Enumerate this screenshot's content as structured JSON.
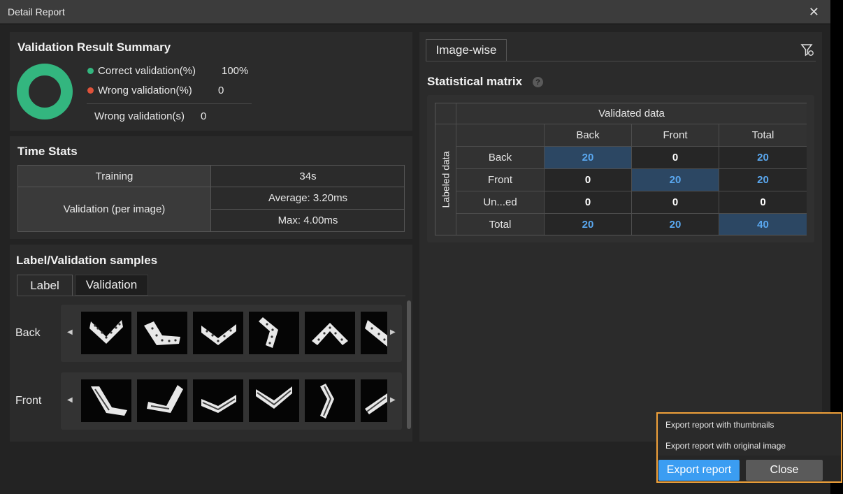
{
  "window": {
    "title": "Detail Report",
    "close_glyph": "✕"
  },
  "summary": {
    "title": "Validation Result Summary",
    "correct_label": "Correct validation(%)",
    "correct_value": "100%",
    "wrong_label": "Wrong validation(%)",
    "wrong_value": "0",
    "wrong_count_label": "Wrong validation(s)",
    "wrong_count_value": "0",
    "correct_fraction": 1.0,
    "colors": {
      "correct": "#33b67f",
      "wrong": "#e0523a"
    }
  },
  "time_stats": {
    "title": "Time Stats",
    "training_label": "Training",
    "training_value": "34s",
    "validation_label": "Validation (per image)",
    "average": "Average: 3.20ms",
    "max": "Max: 4.00ms"
  },
  "samples": {
    "title": "Label/Validation samples",
    "tabs": [
      "Label",
      "Validation"
    ],
    "rows": [
      {
        "label": "Back"
      },
      {
        "label": "Front"
      }
    ]
  },
  "matrix": {
    "tab": "Image-wise",
    "title": "Statistical matrix",
    "help_glyph": "?",
    "top_header": "Validated data",
    "side_header": "Labeled data",
    "col_headers": [
      "Back",
      "Front",
      "Total"
    ],
    "row_headers": [
      "Back",
      "Front",
      "Un...ed",
      "Total"
    ],
    "cells": [
      [
        "20",
        "0",
        "20"
      ],
      [
        "0",
        "20",
        "20"
      ],
      [
        "0",
        "0",
        "0"
      ],
      [
        "20",
        "20",
        "40"
      ]
    ]
  },
  "export": {
    "menu": [
      "Export report with thumbnails",
      "Export report with original image"
    ],
    "export_label": "Export report",
    "close_label": "Close"
  }
}
